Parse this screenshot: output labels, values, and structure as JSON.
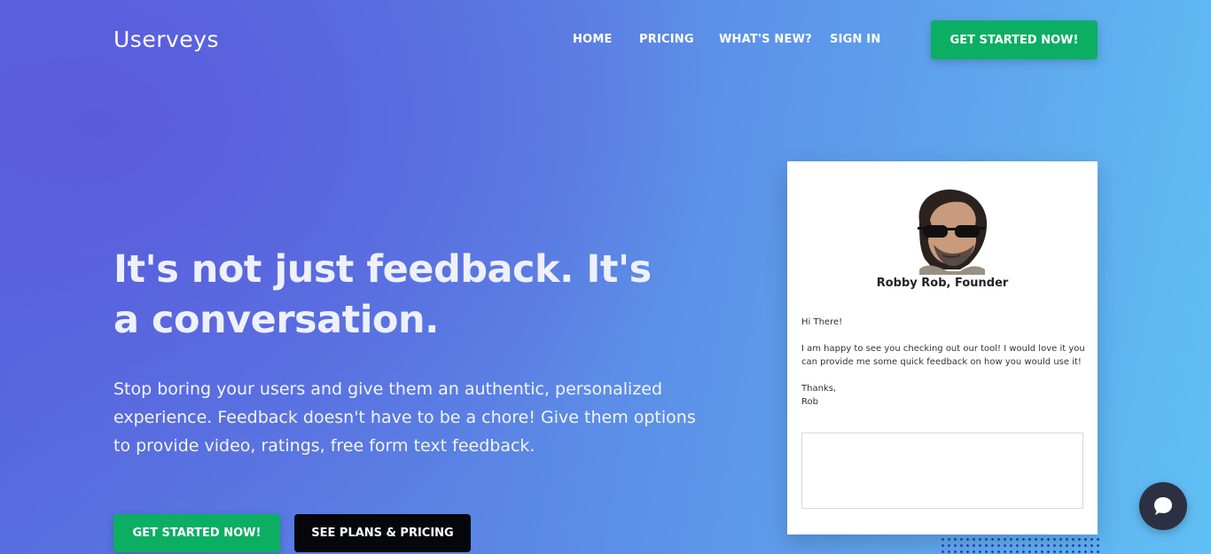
{
  "brand": {
    "name": "Userveys"
  },
  "nav": {
    "items": [
      {
        "label": "HOME"
      },
      {
        "label": "PRICING"
      },
      {
        "label": "WHAT'S NEW?"
      },
      {
        "label": "SIGN IN"
      }
    ],
    "cta_label": "GET STARTED NOW!"
  },
  "hero": {
    "title": "It's not just feedback. It's a conversation.",
    "description": "Stop boring your users and give them an authentic, personalized experience. Feedback doesn't have to be a chore! Give them options to provide video, ratings, free form text feedback.",
    "primary_button": "GET STARTED NOW!",
    "secondary_button": "SEE PLANS & PRICING"
  },
  "feedback_card": {
    "founder_name": "Robby Rob, Founder",
    "greeting": "Hi There!",
    "message": "I am happy to see you checking out our tool! I would love it you can provide me some quick feedback on how you would use it!",
    "sign_off": "Thanks,",
    "signature": "Rob",
    "textarea_value": ""
  },
  "colors": {
    "accent_green": "#0cae64",
    "dark_button": "#06070d",
    "chat_bubble": "#2c3042"
  },
  "icons": {
    "chat": "chat-bubble-icon",
    "avatar": "founder-avatar"
  }
}
